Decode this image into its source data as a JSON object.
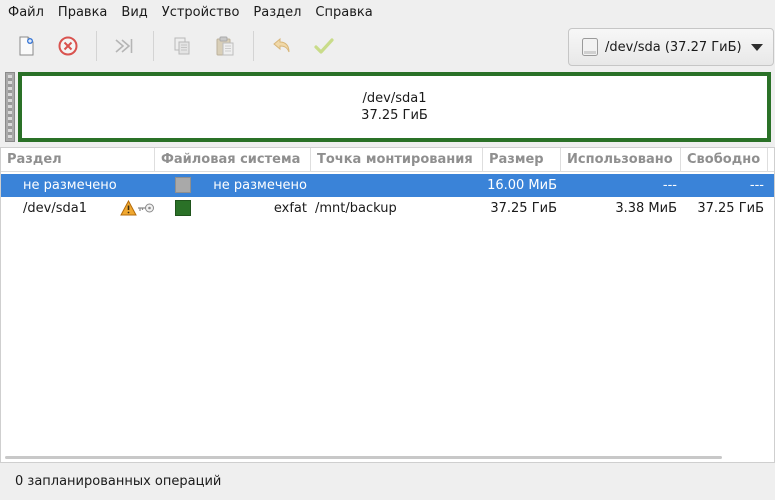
{
  "menu": [
    "Файл",
    "Правка",
    "Вид",
    "Устройство",
    "Раздел",
    "Справка"
  ],
  "toolbar": {
    "buttons": [
      {
        "name": "new-partition",
        "icon": "new-document-icon",
        "enabled": true
      },
      {
        "name": "delete-partition",
        "icon": "delete-circle-icon",
        "enabled": true
      },
      {
        "name": "resize-move",
        "icon": "resize-arrow-icon",
        "enabled": false
      },
      {
        "name": "copy",
        "icon": "copy-icon",
        "enabled": false
      },
      {
        "name": "paste",
        "icon": "paste-icon",
        "enabled": false
      },
      {
        "name": "undo",
        "icon": "undo-icon",
        "enabled": false
      },
      {
        "name": "apply",
        "icon": "checkmark-icon",
        "enabled": false
      }
    ],
    "device": "/dev/sda (37.27 ГиБ)"
  },
  "graphic": {
    "partition": "/dev/sda1",
    "size": "37.25 ГиБ",
    "color": "#2a7127"
  },
  "table": {
    "columns": [
      "Раздел",
      "Файловая система",
      "Точка монтирования",
      "Размер",
      "Использовано",
      "Свободно"
    ],
    "rows": [
      {
        "partition": "не размечено",
        "fs_color": "#a9a9a9",
        "filesystem": "не размечено",
        "mount": "",
        "size": "16.00 МиБ",
        "used": "---",
        "free": "---",
        "selected": true
      },
      {
        "partition": "/dev/sda1",
        "fs_color": "#2a7127",
        "filesystem": "exfat",
        "mount": "/mnt/backup",
        "size": "37.25 ГиБ",
        "used": "3.38 МиБ",
        "free": "37.25 ГиБ",
        "selected": false,
        "icons": [
          "warning-icon",
          "key-icon"
        ]
      }
    ]
  },
  "status": "0 запланированных операций"
}
